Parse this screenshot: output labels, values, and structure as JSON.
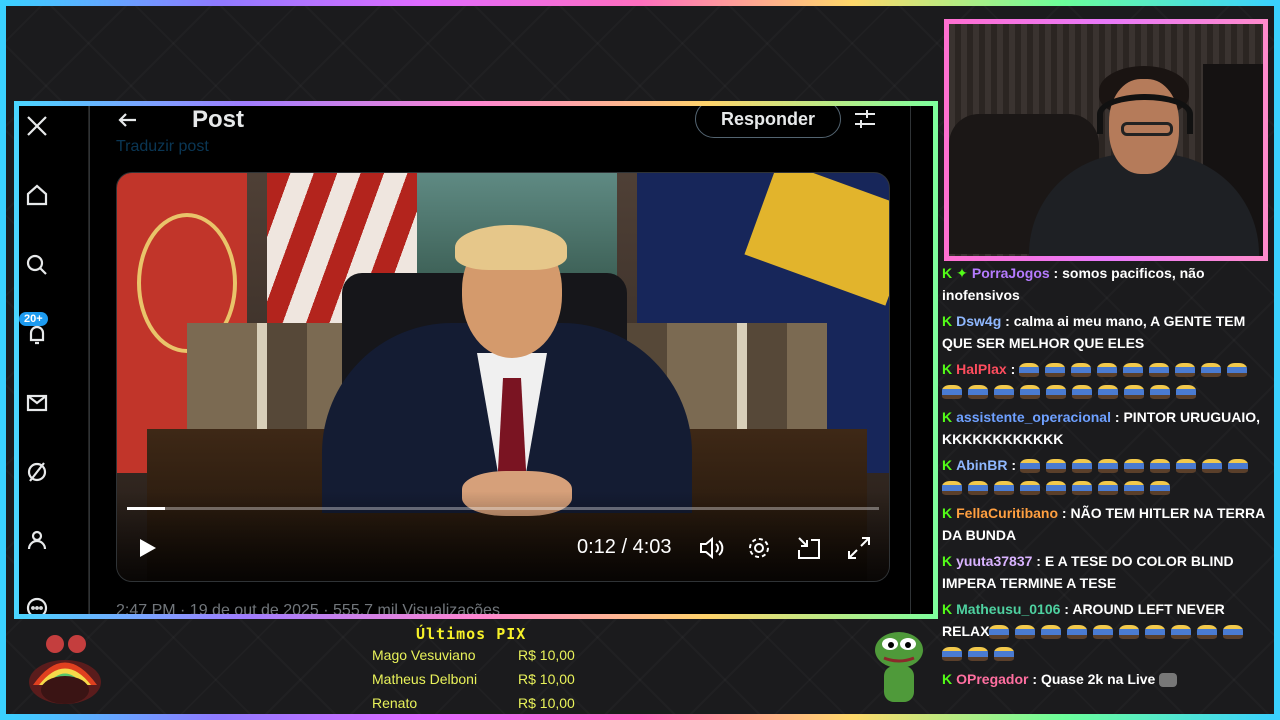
{
  "post": {
    "title": "Post",
    "reply_label": "Responder",
    "translate_label": "Traduzir post",
    "meta_text": "2:47 PM · 19 de out de 2025 · 555,7 mil Visualizações"
  },
  "video": {
    "current_time": "0:12",
    "separator": "/",
    "duration": "4:03",
    "progress": 0.05
  },
  "nav": {
    "notification_badge": "20+",
    "icons": [
      "x-logo-icon",
      "home-icon",
      "search-icon",
      "notifications-icon",
      "messages-icon",
      "grok-icon",
      "profile-icon",
      "more-icon"
    ]
  },
  "chat": {
    "messages": [
      {
        "user": "PorraJogos",
        "color": "#b57bff",
        "badge2": true,
        "text": "somos pacificos, não inofensivos",
        "emotes": 0
      },
      {
        "user": "Dsw4g",
        "color": "#8fb8ff",
        "badge2": false,
        "text": "calma ai meu mano, A GENTE TEM QUE SER MELHOR QUE ELES",
        "emotes": 0
      },
      {
        "user": "HalPlax",
        "color": "#ff4d5e",
        "badge2": false,
        "text": "",
        "emotes": 19
      },
      {
        "user": "assistente_operacional",
        "color": "#6ea0ff",
        "badge2": false,
        "text": "PINTOR URUGUAIO, KKKKKKKKKKKK",
        "emotes": 0
      },
      {
        "user": "AbinBR",
        "color": "#8fb8ff",
        "badge2": false,
        "text": "",
        "emotes": 18
      },
      {
        "user": "FellaCuritibano",
        "color": "#ff9f40",
        "badge2": false,
        "text": "NÃO TEM HITLER NA TERRA DA BUNDA",
        "emotes": 0
      },
      {
        "user": "yuuta37837",
        "color": "#d9b3ff",
        "badge2": false,
        "text": "E A TESE DO COLOR BLIND IMPERA TERMINE A TESE",
        "emotes": 0
      },
      {
        "user": "Matheusu_0106",
        "color": "#4ed1a0",
        "badge2": false,
        "text": "AROUND LEFT NEVER RELAX",
        "emotes": 13
      },
      {
        "user": "OPregador",
        "color": "#ff6fa0",
        "badge2": false,
        "text": "Quase 2k na Live",
        "emotes": 0
      }
    ]
  },
  "donations": {
    "title": "Últimos PIX",
    "items": [
      {
        "name": "Mago Vesuviano",
        "amount": "R$ 10,00"
      },
      {
        "name": "Matheus Delboni",
        "amount": "R$ 10,00"
      },
      {
        "name": "Renato",
        "amount": "R$ 10,00"
      }
    ]
  },
  "colors": {
    "accent_blue": "#1d9bf0",
    "chat_badge": "#53fc18",
    "donation_text": "#e9f25a"
  }
}
